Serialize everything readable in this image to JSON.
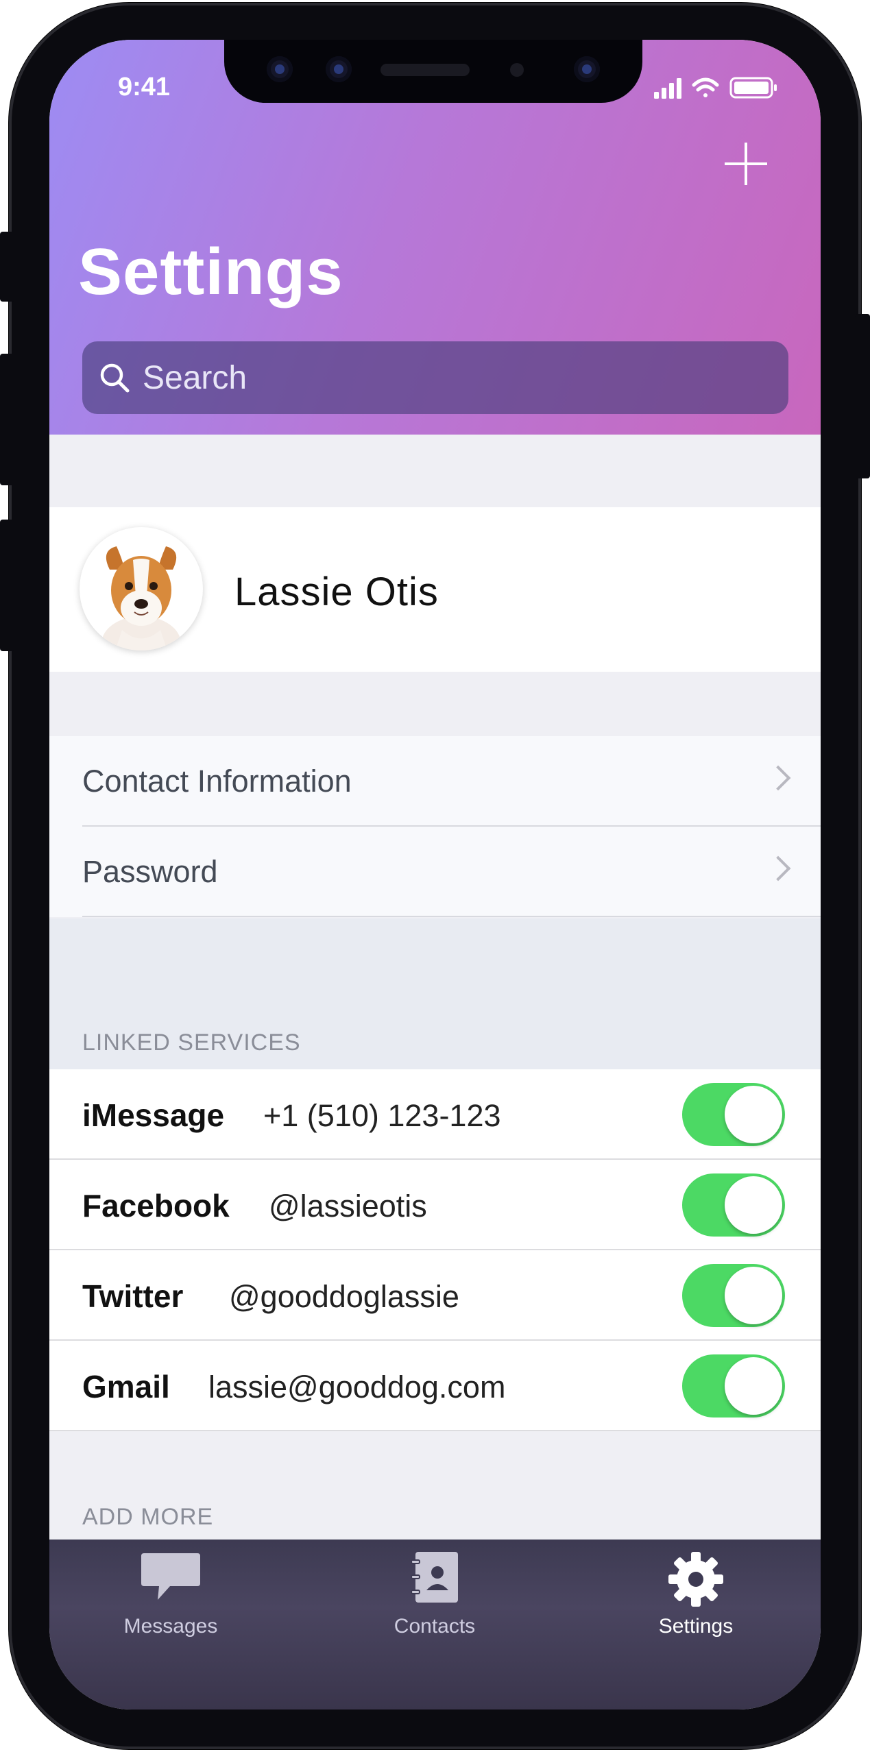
{
  "status": {
    "time": "9:41"
  },
  "header": {
    "title": "Settings",
    "add_icon": "plus-icon",
    "search_placeholder": "Search"
  },
  "profile": {
    "name": "Lassie Otis",
    "avatar_icon": "dog-avatar"
  },
  "account_rows": [
    {
      "label": "Contact Information"
    },
    {
      "label": "Password"
    }
  ],
  "linked_services": {
    "header": "LINKED SERVICES",
    "items": [
      {
        "service": "iMessage",
        "account": "+1 (510) 123-123",
        "enabled": true
      },
      {
        "service": "Facebook",
        "account": "@lassieotis",
        "enabled": true
      },
      {
        "service": "Twitter",
        "account": "@gooddoglassie",
        "enabled": true
      },
      {
        "service": "Gmail",
        "account": "lassie@gooddog.com",
        "enabled": true
      }
    ]
  },
  "add_more": {
    "header": "ADD MORE"
  },
  "tabbar": {
    "items": [
      {
        "label": "Messages",
        "icon": "speech-bubble-icon",
        "active": false
      },
      {
        "label": "Contacts",
        "icon": "address-book-icon",
        "active": false
      },
      {
        "label": "Settings",
        "icon": "gear-icon",
        "active": true
      }
    ]
  },
  "colors": {
    "header_gradient_start": "#9d8cf3",
    "header_gradient_end": "#c867bd",
    "toggle_on": "#4cd964",
    "tabbar_bg": "#3d3a52"
  }
}
